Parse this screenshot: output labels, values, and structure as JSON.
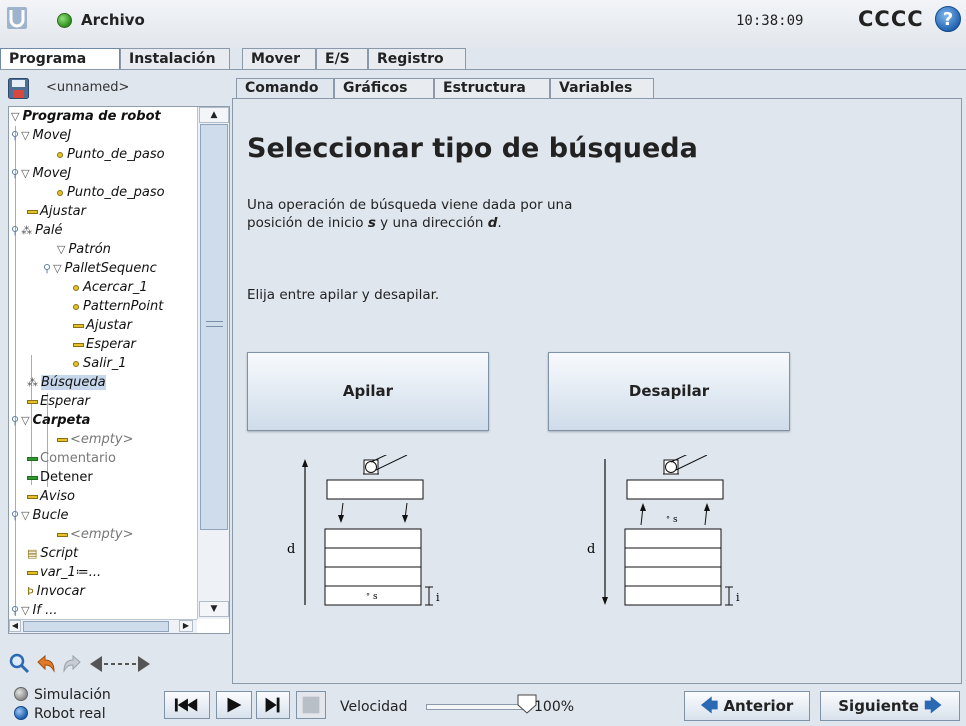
{
  "header": {
    "file_label": "Archivo",
    "clock": "10:38:09",
    "robot_name": "CCCC",
    "help_glyph": "?"
  },
  "top_tabs": [
    "Programa",
    "Instalación",
    "Mover",
    "E/S",
    "Registro"
  ],
  "program": {
    "name": "<unnamed>"
  },
  "tree": [
    {
      "label": "Programa de robot",
      "icon": "triangle"
    },
    {
      "label": "MoveJ",
      "icon": "triangle"
    },
    {
      "label": "Punto_de_paso",
      "icon": "waypoint"
    },
    {
      "label": "MoveJ",
      "icon": "triangle"
    },
    {
      "label": "Punto_de_paso",
      "icon": "waypoint"
    },
    {
      "label": "Ajustar",
      "icon": "bar-gold"
    },
    {
      "label": "Palé",
      "icon": "pallet"
    },
    {
      "label": "Patrón",
      "icon": "triangle"
    },
    {
      "label": "PalletSequenc",
      "icon": "triangle"
    },
    {
      "label": "Acercar_1",
      "icon": "waypoint"
    },
    {
      "label": "PatternPoint",
      "icon": "waypoint"
    },
    {
      "label": "Ajustar",
      "icon": "bar-gold"
    },
    {
      "label": "Esperar",
      "icon": "bar-gold"
    },
    {
      "label": "Salir_1",
      "icon": "waypoint"
    },
    {
      "label": "Búsqueda",
      "icon": "pallet"
    },
    {
      "label": "Esperar",
      "icon": "bar-gold"
    },
    {
      "label": "Carpeta",
      "icon": "triangle"
    },
    {
      "label": "<empty>",
      "icon": "bar-gold"
    },
    {
      "label": "Comentario",
      "icon": "bar-green"
    },
    {
      "label": "Detener",
      "icon": "bar-green"
    },
    {
      "label": "Aviso",
      "icon": "bar-gold"
    },
    {
      "label": "Bucle",
      "icon": "triangle"
    },
    {
      "label": "<empty>",
      "icon": "bar-gold"
    },
    {
      "label": "Script",
      "icon": "script"
    },
    {
      "label": "var_1≔...",
      "icon": "bar-gold"
    },
    {
      "label": "Invocar",
      "icon": "call"
    },
    {
      "label": "If ...",
      "icon": "triangle"
    }
  ],
  "sub_tabs": [
    "Comando",
    "Gráficos",
    "Estructura",
    "Variables"
  ],
  "main": {
    "title": "Seleccionar tipo de búsqueda",
    "desc_line1": "Una operación de búsqueda viene dada por una",
    "desc_line2_pre": "posición de inicio ",
    "desc_s": "s",
    "desc_line2_mid": " y una dirección ",
    "desc_d": "d",
    "desc_line2_end": ".",
    "choose": "Elija entre apilar y desapilar.",
    "stack_button": "Apilar",
    "destack_button": "Desapilar",
    "diagram_labels": {
      "d": "d",
      "s": "s",
      "i": "i"
    }
  },
  "footer": {
    "mode_sim": "Simulación",
    "mode_real": "Robot real",
    "speed_label": "Velocidad",
    "speed_value": "100%",
    "speed_fraction": 1.0,
    "prev_button": "Anterior",
    "next_button": "Siguiente"
  },
  "colors": {
    "accent_blue": "#2c69b5",
    "sim_mode": "#8a8a8a",
    "real_mode": "#1e5fae",
    "selected_node": "#c6d7ec"
  }
}
